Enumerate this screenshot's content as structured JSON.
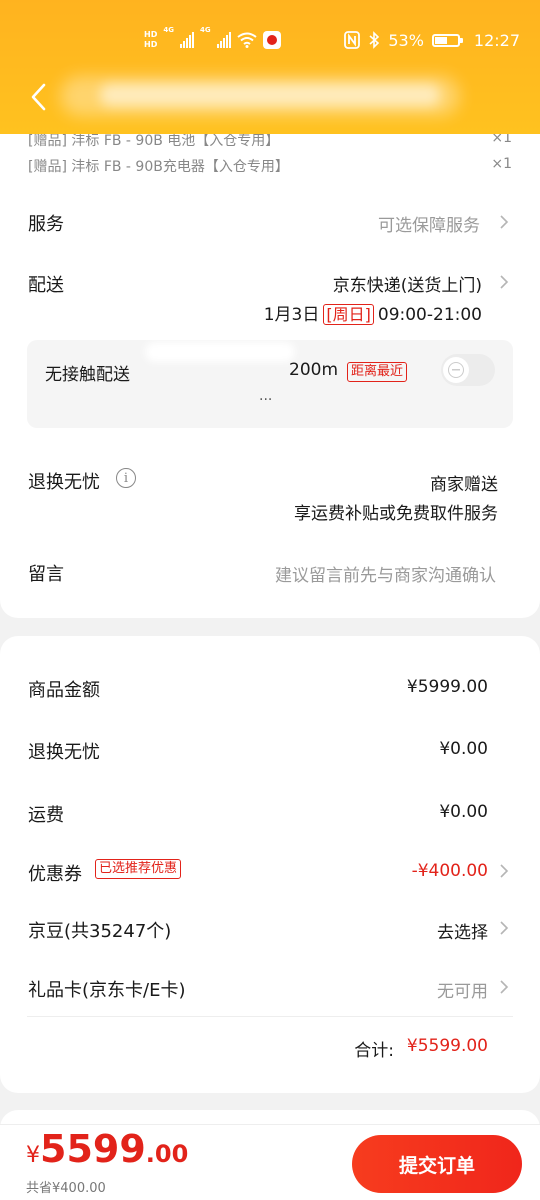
{
  "statusbar": {
    "hd1": "HD",
    "hd2": "HD",
    "net1": "4G",
    "net2": "4G",
    "battery_pct": "53%",
    "time": "12:27"
  },
  "header": {
    "back_icon": "chevron-left-icon"
  },
  "order": {
    "gifts": [
      {
        "label": "[赠品]  沣标 FB - 90B 电池【入仓专用】",
        "qty": "×1"
      },
      {
        "label": "[赠品]  沣标 FB - 90B充电器【入仓专用】",
        "qty": "×1"
      }
    ],
    "service": {
      "label": "服务",
      "value": "可选保障服务"
    },
    "delivery": {
      "label": "配送",
      "carrier": "京东快递(送货上门)",
      "date": "1月3日",
      "weekday": "[周日]",
      "time_range": "09:00-21:00"
    },
    "no_contact": {
      "label": "无接触配送",
      "distance": "200m",
      "badge": "距离最近",
      "dots": "...",
      "enabled": false
    },
    "return_worry_free": {
      "label": "退换无忧",
      "value": "商家赠送",
      "subvalue": "享运费补贴或免费取件服务"
    },
    "message": {
      "label": "留言",
      "placeholder": "建议留言前先与商家沟通确认"
    }
  },
  "summary": {
    "goods_amount": {
      "label": "商品金额",
      "value": "¥5999.00"
    },
    "return_fee": {
      "label": "退换无忧",
      "value": "¥0.00"
    },
    "shipping": {
      "label": "运费",
      "value": "¥0.00"
    },
    "coupon": {
      "label": "优惠券",
      "badge": "已选推荐优惠",
      "value": "-¥400.00"
    },
    "jd_beans": {
      "label": "京豆(共35247个)",
      "value": "去选择"
    },
    "gift_card": {
      "label": "礼品卡(京东卡/E卡)",
      "value": "无可用"
    },
    "total": {
      "label": "合计:",
      "value": "¥5599.00"
    }
  },
  "bottom": {
    "currency": "¥",
    "price_int": "5599",
    "price_dec": ".00",
    "saved": "共省¥400.00",
    "submit_label": "提交订单"
  },
  "colors": {
    "header": "#ffb31f",
    "accent_red": "#e2231a",
    "submit": "#f73c1e"
  }
}
